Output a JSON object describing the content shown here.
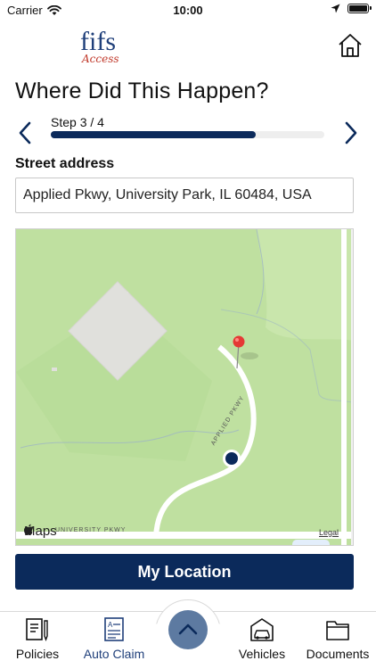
{
  "status_bar": {
    "carrier": "Carrier",
    "time": "10:00"
  },
  "header": {
    "logo_text": "fifs",
    "logo_script": "Access"
  },
  "page": {
    "title": "Where Did This Happen?",
    "step_label": "Step 3 / 4",
    "step_progress": 0.75
  },
  "address": {
    "label": "Street address",
    "value": "Applied Pkwy, University Park, IL 60484, USA"
  },
  "map": {
    "provider_label": "Maps",
    "legal_label": "Legal",
    "roads": [
      "APPLIED PKWY",
      "UNIVERSITY PKWY"
    ]
  },
  "actions": {
    "my_location_label": "My Location"
  },
  "tabs": [
    {
      "label": "Policies",
      "icon": "document-pencil-icon"
    },
    {
      "label": "Auto Claim",
      "icon": "claim-form-icon",
      "active": true
    },
    {
      "label": "Vehicles",
      "icon": "car-garage-icon"
    },
    {
      "label": "Documents",
      "icon": "folder-icon"
    }
  ],
  "colors": {
    "primary": "#0b2a5b",
    "fab": "#5d7aa1",
    "active_tab": "#1f3f7a",
    "map_pin": "#e53935",
    "user_dot": "#0b2a5b"
  }
}
